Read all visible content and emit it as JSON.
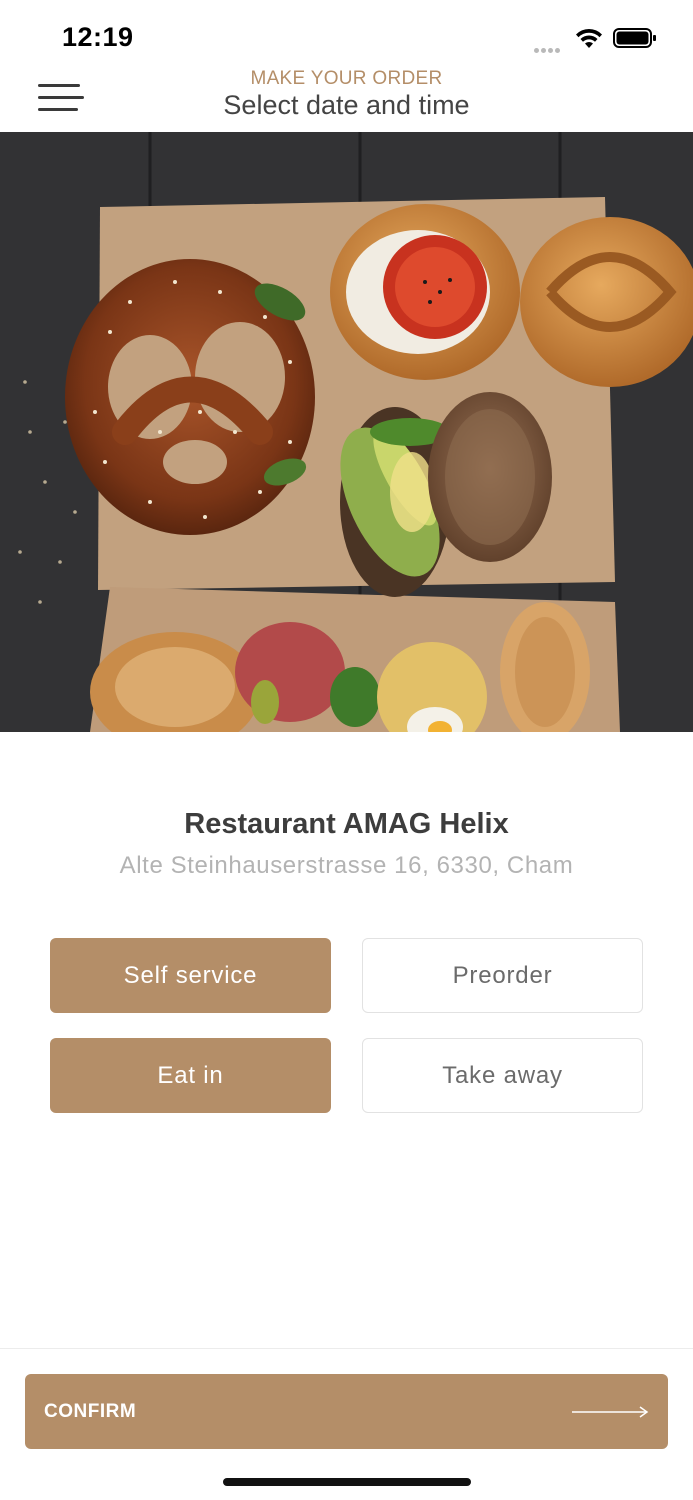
{
  "status_bar": {
    "time": "12:19"
  },
  "header": {
    "subtitle": "MAKE YOUR ORDER",
    "title": "Select date and time"
  },
  "restaurant": {
    "name": "Restaurant AMAG Helix",
    "address": "Alte Steinhauserstrasse 16, 6330, Cham"
  },
  "options": {
    "service_type": {
      "selected": "Self service",
      "other": "Preorder"
    },
    "dining_type": {
      "selected": "Eat in",
      "other": "Take away"
    }
  },
  "confirm": {
    "label": "CONFIRM"
  },
  "colors": {
    "accent": "#b48e68",
    "title": "#444444",
    "address": "#b3b3b3"
  }
}
